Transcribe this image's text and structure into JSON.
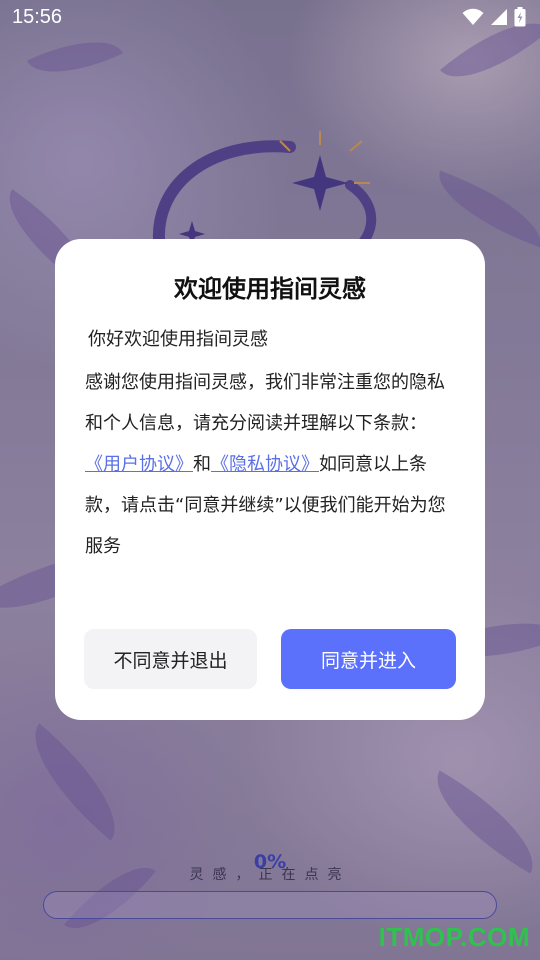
{
  "status_bar": {
    "time": "15:56"
  },
  "dialog": {
    "title": "欢迎使用指间灵感",
    "greeting": "你好欢迎使用指间灵感",
    "paragraph_1": "感谢您使用指间灵感，我们非常注重您的隐私和个人信息，请充分阅读并理解以下条款：",
    "user_agreement_link": "《用户协议》",
    "and_text": "和",
    "privacy_policy_link": "《隐私协议》",
    "paragraph_2": "如同意以上条款，请点击“同意并继续”以便我们能开始为您服务",
    "decline_button": "不同意并退出",
    "accept_button": "同意并进入"
  },
  "loading": {
    "text": "灵感，正在点亮",
    "percent_label": "0%",
    "progress": 0
  },
  "watermark": "ITMOP.COM",
  "colors": {
    "accent": "#5b71fb",
    "link": "#5b6fe6",
    "watermark": "#2fc24e"
  }
}
